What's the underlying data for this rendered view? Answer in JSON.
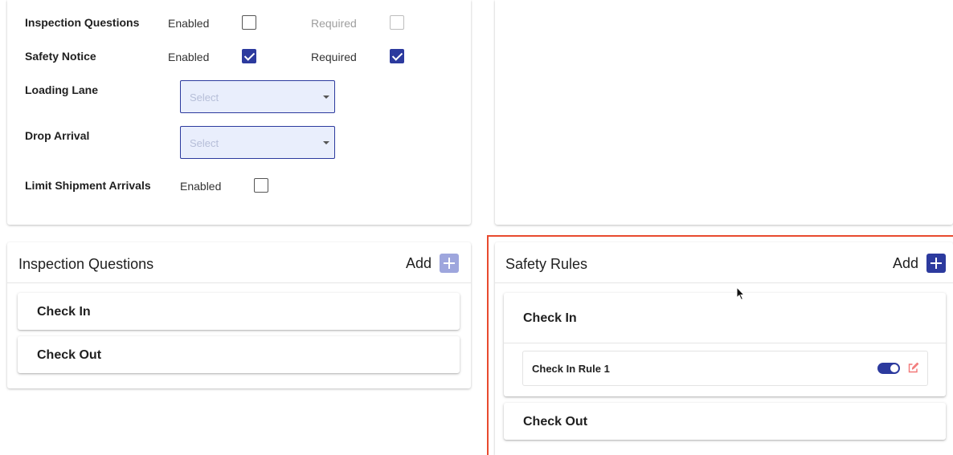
{
  "settings": {
    "rows": [
      {
        "label": "Inspection Questions",
        "enabled_label": "Enabled",
        "enabled_checked": false,
        "required_label": "Required",
        "required_checked": false
      },
      {
        "label": "Safety Notice",
        "enabled_label": "Enabled",
        "enabled_checked": true,
        "required_label": "Required",
        "required_checked": true
      }
    ],
    "loading_lane": {
      "label": "Loading Lane",
      "placeholder": "Select"
    },
    "drop_arrival": {
      "label": "Drop Arrival",
      "placeholder": "Select"
    },
    "limit_shipment": {
      "label": "Limit Shipment Arrivals",
      "enabled_label": "Enabled",
      "enabled_checked": false
    }
  },
  "inspection_questions": {
    "title": "Inspection Questions",
    "add_label": "Add",
    "panels": [
      {
        "title": "Check In"
      },
      {
        "title": "Check Out"
      }
    ]
  },
  "safety_rules": {
    "title": "Safety Rules",
    "add_label": "Add",
    "panels": [
      {
        "title": "Check In",
        "rules": [
          {
            "label": "Check In Rule 1",
            "active": true
          }
        ]
      },
      {
        "title": "Check Out"
      }
    ]
  },
  "colors": {
    "accent": "#2c3a9e",
    "accent_faded": "#9ea6dd",
    "select_bg": "#e9eefc",
    "highlight_outline": "#e84a2e",
    "edit_icon": "#f27878"
  },
  "icons": {
    "add": "plus-icon",
    "edit": "edit-icon",
    "select": "chevron-down-icon",
    "pointer": "mouse-cursor-icon"
  }
}
